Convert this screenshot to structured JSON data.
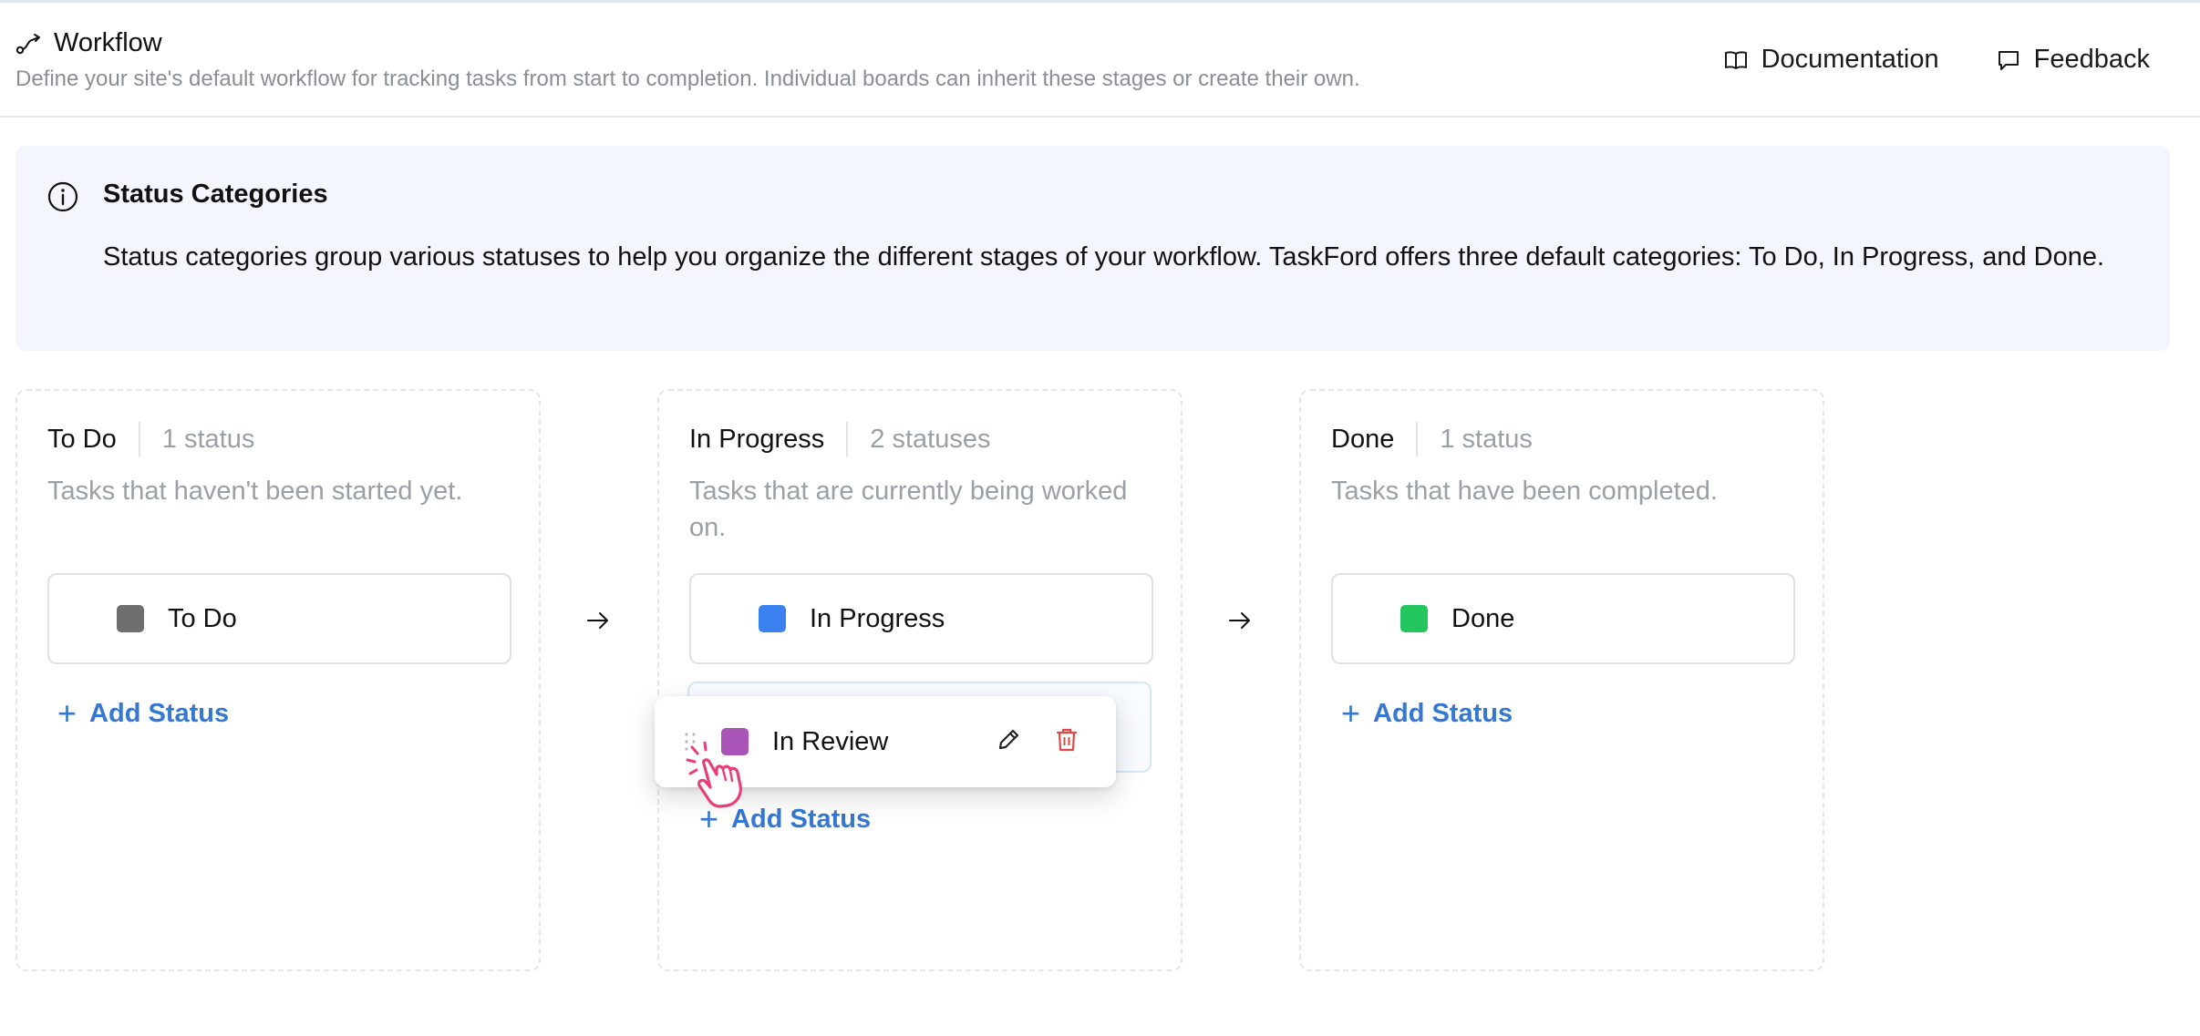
{
  "header": {
    "title": "Workflow",
    "subtitle": "Define your site's default workflow for tracking tasks from start to completion. Individual boards can inherit these stages or create their own.",
    "documentation_label": "Documentation",
    "feedback_label": "Feedback"
  },
  "info": {
    "heading": "Status Categories",
    "body": "Status categories group various statuses to help you organize the different stages of your workflow. TaskFord offers three default categories: To Do, In Progress, and Done."
  },
  "columns": [
    {
      "name": "To Do",
      "count": "1 status",
      "description": "Tasks that haven't been started yet.",
      "statuses": [
        {
          "label": "To Do",
          "color": "#6f6f6f"
        }
      ],
      "add_label": "Add Status"
    },
    {
      "name": "In Progress",
      "count": "2 statuses",
      "description": "Tasks that are currently being worked on.",
      "statuses": [
        {
          "label": "In Progress",
          "color": "#3b82f0"
        }
      ],
      "add_label": "Add Status"
    },
    {
      "name": "Done",
      "count": "1 status",
      "description": "Tasks that have been completed.",
      "statuses": [
        {
          "label": "Done",
          "color": "#22c55e"
        }
      ],
      "add_label": "Add Status"
    }
  ],
  "dragging": {
    "label": "In Review",
    "color": "#a855b7"
  },
  "colors": {
    "accent": "#3478d4",
    "delete": "#e04848",
    "cursor": "#e83e7a"
  },
  "icons": [
    "workflow-icon",
    "book-icon",
    "message-icon",
    "info-icon",
    "arrow-right-icon",
    "plus-icon",
    "grip-icon",
    "pencil-icon",
    "trash-icon",
    "hand-cursor-icon"
  ]
}
